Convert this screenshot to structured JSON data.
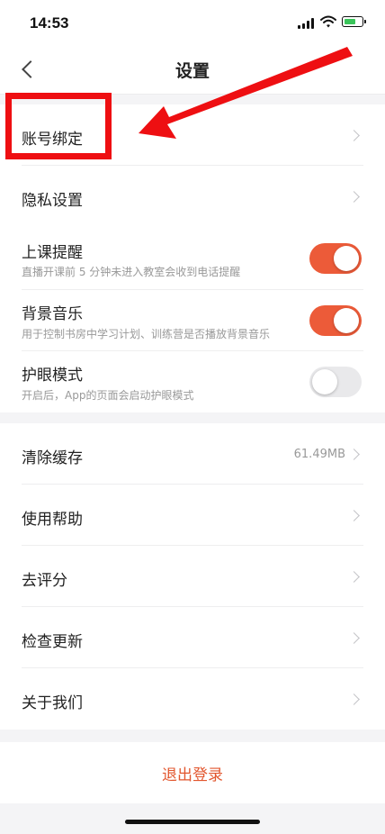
{
  "status_bar": {
    "time": "14:53"
  },
  "nav": {
    "title": "设置"
  },
  "section_account": {
    "items": [
      {
        "label": "账号绑定"
      },
      {
        "label": "隐私设置"
      }
    ]
  },
  "section_toggles": {
    "items": [
      {
        "label": "上课提醒",
        "sub": "直播开课前 5 分钟未进入教室会收到电话提醒",
        "on": true
      },
      {
        "label": "背景音乐",
        "sub": "用于控制书房中学习计划、训练营是否播放背景音乐",
        "on": true
      },
      {
        "label": "护眼模式",
        "sub": "开启后，App的页面会启动护眼模式",
        "on": false
      }
    ]
  },
  "section_misc": {
    "items": [
      {
        "label": "清除缓存",
        "value": "61.49MB"
      },
      {
        "label": "使用帮助"
      },
      {
        "label": "去评分"
      },
      {
        "label": "检查更新"
      },
      {
        "label": "关于我们"
      }
    ]
  },
  "logout": {
    "label": "退出登录"
  },
  "colors": {
    "accent": "#ec5b39",
    "logout_text": "#e2572f",
    "annotation_red": "#ee0f12"
  },
  "icons": [
    "back-chevron-icon",
    "chevron-right-icon",
    "signal-icon",
    "wifi-icon",
    "battery-charging-icon"
  ]
}
